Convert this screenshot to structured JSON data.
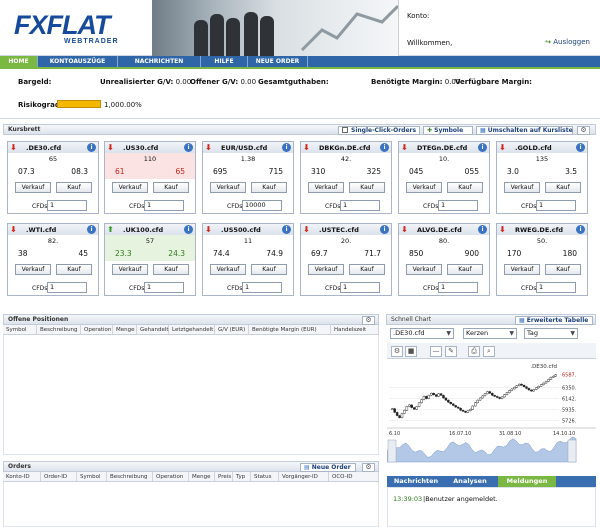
{
  "brand": {
    "logo_main": "FXFLAT",
    "logo_sub": "WEBTRADER"
  },
  "account": {
    "konto_label": "Konto:",
    "welcome": "Willkommen,",
    "logout": "Ausloggen"
  },
  "nav": [
    {
      "label": "HOME",
      "active": true
    },
    {
      "label": "KONTOAUSZÜGE"
    },
    {
      "label": "NACHRICHTEN"
    },
    {
      "label": "HILFE"
    },
    {
      "label": "NEUE ORDER"
    }
  ],
  "summary": {
    "bargeld": "Bargeld:",
    "unrealisiert_label": "Unrealisierter G/V:",
    "unrealisiert_value": "0.00",
    "offener_label": "Offener G/V:",
    "offener_value": "0.00",
    "gesamt_label": "Gesamtguthaben:",
    "margin_label": "Benötigte Margin:",
    "margin_value": "0.00",
    "verfuegbar_label": "Verfügbare Margin:",
    "risiko_label": "Risikograd",
    "risiko_value": "1,000.00%"
  },
  "kursbrett": {
    "title": "Kursbrett",
    "single_click": "Single-Click-Orders",
    "symbole": "Symbole",
    "umschalten": "Umschalten auf Kursliste"
  },
  "tile_labels": {
    "verkauf": "Verkauf",
    "kauf": "Kauf",
    "cfds": "CFDs"
  },
  "tiles": [
    {
      "symbol": ".DE30.cfd",
      "dir": "down",
      "pip": "65",
      "bid": "07.3",
      "ask": "08.3",
      "cfds": "1",
      "state": "none"
    },
    {
      "symbol": ".US30.cfd",
      "dir": "down",
      "pip": "110",
      "bid": "61",
      "ask": "65",
      "cfds": "1",
      "state": "red"
    },
    {
      "symbol": "EUR/USD.cfd",
      "dir": "down",
      "pip": "1.38",
      "bid": "695",
      "ask": "715",
      "cfds": "10000",
      "state": "none"
    },
    {
      "symbol": "DBKGn.DE.cfd",
      "dir": "down",
      "pip": "42.",
      "bid": "310",
      "ask": "325",
      "cfds": "1",
      "state": "none"
    },
    {
      "symbol": "DTEGn.DE.cfd",
      "dir": "down",
      "pip": "10.",
      "bid": "045",
      "ask": "055",
      "cfds": "1",
      "state": "none"
    },
    {
      "symbol": ".GOLD.cfd",
      "dir": "down",
      "pip": "135",
      "bid": "3.0",
      "ask": "3.5",
      "cfds": "1",
      "state": "none"
    },
    {
      "symbol": ".WTI.cfd",
      "dir": "down",
      "pip": "82.",
      "bid": "38",
      "ask": "45",
      "cfds": "1",
      "state": "none"
    },
    {
      "symbol": ".UK100.cfd",
      "dir": "up",
      "pip": "57",
      "bid": "23.3",
      "ask": "24.3",
      "cfds": "1",
      "state": "green"
    },
    {
      "symbol": ".US500.cfd",
      "dir": "down",
      "pip": "11",
      "bid": "74.4",
      "ask": "74.9",
      "cfds": "1",
      "state": "none"
    },
    {
      "symbol": ".USTEC.cfd",
      "dir": "down",
      "pip": "20.",
      "bid": "69.7",
      "ask": "71.7",
      "cfds": "1",
      "state": "none"
    },
    {
      "symbol": "ALVG.DE.cfd",
      "dir": "down",
      "pip": "80.",
      "bid": "850",
      "ask": "900",
      "cfds": "1",
      "state": "none"
    },
    {
      "symbol": "RWEG.DE.cfd",
      "dir": "down",
      "pip": "50.",
      "bid": "170",
      "ask": "180",
      "cfds": "1",
      "state": "none"
    }
  ],
  "offene": {
    "title": "Offene Positionen",
    "columns": [
      "Symbol",
      "Beschreibung",
      "Operation",
      "Menge",
      "Gehandelt",
      "Letztgehandelt",
      "G/V (EUR)",
      "Benötigte Margin (EUR)",
      "Handelszeit"
    ]
  },
  "orders": {
    "title": "Orders",
    "neue_order": "Neue Order",
    "columns": [
      "Konto-ID",
      "Order-ID",
      "Symbol",
      "Beschreibung",
      "Operation",
      "Menge",
      "Preis",
      "Typ",
      "Status",
      "Vorgänger-ID",
      "OCO-ID"
    ]
  },
  "chart": {
    "title": "Schnell Chart",
    "erweiterte": "Erweiterte Tabelle",
    "symbol_select": ".DE30.cfd",
    "type_select": "Kerzen",
    "period_select": "Tag",
    "chart_label": ".DE30.cfd",
    "last_price": "6587.",
    "y_ticks": [
      "6350.",
      "6142.",
      "5935.",
      "5726."
    ],
    "x_ticks": [
      "6.10",
      "16.07.10",
      "31.08.10",
      "14.10.10"
    ]
  },
  "chart_data": {
    "type": "candlestick",
    "title": ".DE30.cfd",
    "x": [
      "6.10",
      "16.07.10",
      "31.08.10",
      "14.10.10"
    ],
    "ylim": [
      5700,
      6600
    ],
    "yticks": [
      6350,
      6142,
      5935,
      5726
    ],
    "last": 6587,
    "closes": [
      5950,
      5880,
      5820,
      5780,
      5860,
      5920,
      5990,
      6020,
      5970,
      5940,
      5990,
      6060,
      6120,
      6180,
      6140,
      6200,
      6240,
      6210,
      6180,
      6230,
      6200,
      6150,
      6110,
      6070,
      6040,
      6010,
      5980,
      5960,
      5920,
      5900,
      5880,
      5910,
      5940,
      6000,
      6060,
      6110,
      6150,
      6190,
      6230,
      6270,
      6240,
      6200,
      6180,
      6160,
      6140,
      6170,
      6210,
      6250,
      6290,
      6320,
      6350,
      6380,
      6410,
      6390,
      6360,
      6330,
      6300,
      6280,
      6310,
      6340,
      6370,
      6400,
      6430,
      6460,
      6500,
      6540,
      6560,
      6587
    ]
  },
  "bottom": {
    "tabs": [
      "Nachrichten",
      "Analysen",
      "Meldungen"
    ],
    "msg_time": "13:39:03",
    "msg_text": "Benutzer angemeldet."
  }
}
